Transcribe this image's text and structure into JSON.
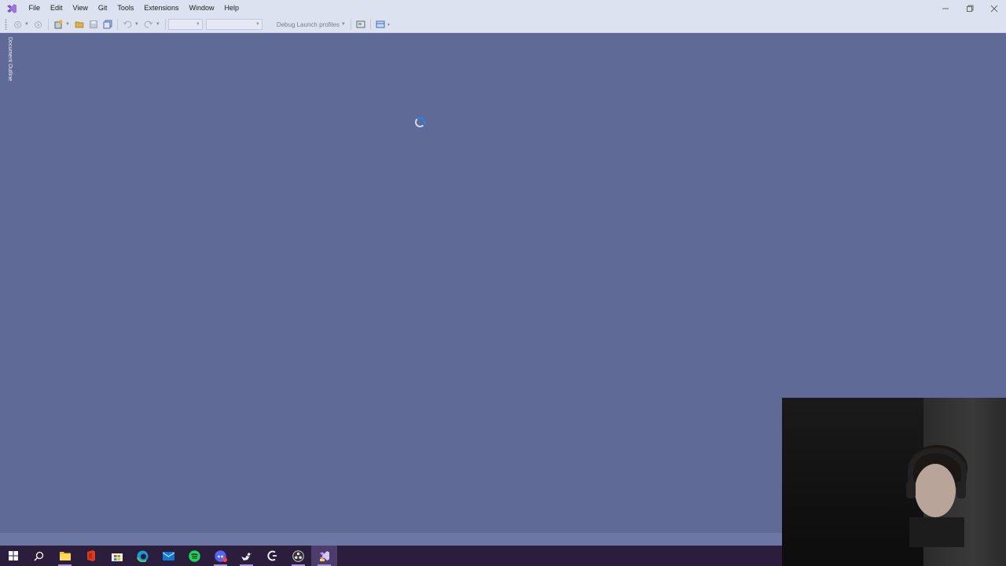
{
  "menu": {
    "items": [
      "File",
      "Edit",
      "View",
      "Git",
      "Tools",
      "Extensions",
      "Window",
      "Help"
    ]
  },
  "toolbar": {
    "launch_profile_label": "Debug Launch profiles"
  },
  "side_tab": {
    "label": "Document Outline"
  },
  "colors": {
    "chrome": "#dde2f1",
    "editor_bg": "#5f6a97",
    "taskbar": "#2a1e3c",
    "accent": "#68217a"
  },
  "taskbar": {
    "icons": [
      "start-icon",
      "search-icon",
      "file-explorer-icon",
      "office-icon",
      "store-icon",
      "edge-icon",
      "mail-icon",
      "spotify-icon",
      "discord-icon",
      "steam-icon",
      "logitech-icon",
      "obs-icon",
      "visual-studio-icon"
    ]
  }
}
